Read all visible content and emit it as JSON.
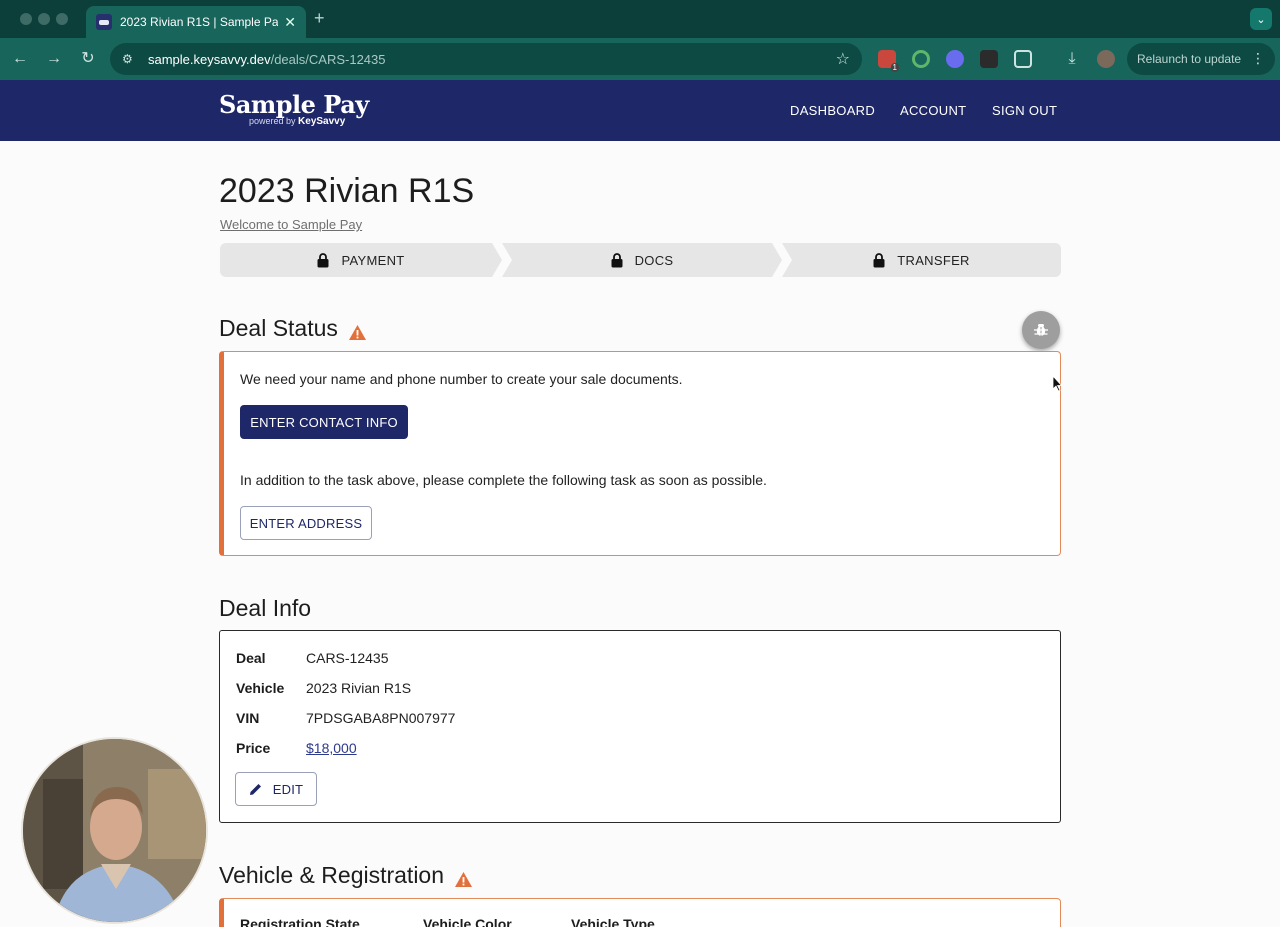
{
  "browser": {
    "tab_title": "2023 Rivian R1S | Sample Pay",
    "new_tab_symbol": "+",
    "url_host": "sample.keysavvy.dev",
    "url_path": "/deals/CARS-12435",
    "relaunch_label": "Relaunch to update",
    "extension_badge": "1"
  },
  "site": {
    "logo_main": "Sample Pay",
    "logo_powered": "powered by",
    "logo_brand": "KeySavvy",
    "nav": [
      "DASHBOARD",
      "ACCOUNT",
      "SIGN OUT"
    ]
  },
  "deal": {
    "title": "2023 Rivian R1S",
    "welcome": "Welcome to Sample Pay",
    "steps": [
      "PAYMENT",
      "DOCS",
      "TRANSFER"
    ]
  },
  "status": {
    "heading": "Deal Status",
    "message1": "We need your name and phone number to create your sale documents.",
    "button1": "ENTER CONTACT INFO",
    "message2": "In addition to the task above, please complete the following task as soon as possible.",
    "button2": "ENTER ADDRESS"
  },
  "info": {
    "heading": "Deal Info",
    "rows": [
      {
        "label": "Deal",
        "value": "CARS-12435"
      },
      {
        "label": "Vehicle",
        "value": "2023 Rivian R1S"
      },
      {
        "label": "VIN",
        "value": "7PDSGABA8PN007977"
      },
      {
        "label": "Price",
        "value": "$18,000"
      }
    ],
    "edit_label": "EDIT"
  },
  "registration": {
    "heading": "Vehicle & Registration",
    "columns": [
      "Registration State",
      "Vehicle Color",
      "Vehicle Type"
    ]
  },
  "colors": {
    "brand_navy": "#1e2767",
    "warning_orange": "#e2703a",
    "browser_teal": "#17655b"
  }
}
